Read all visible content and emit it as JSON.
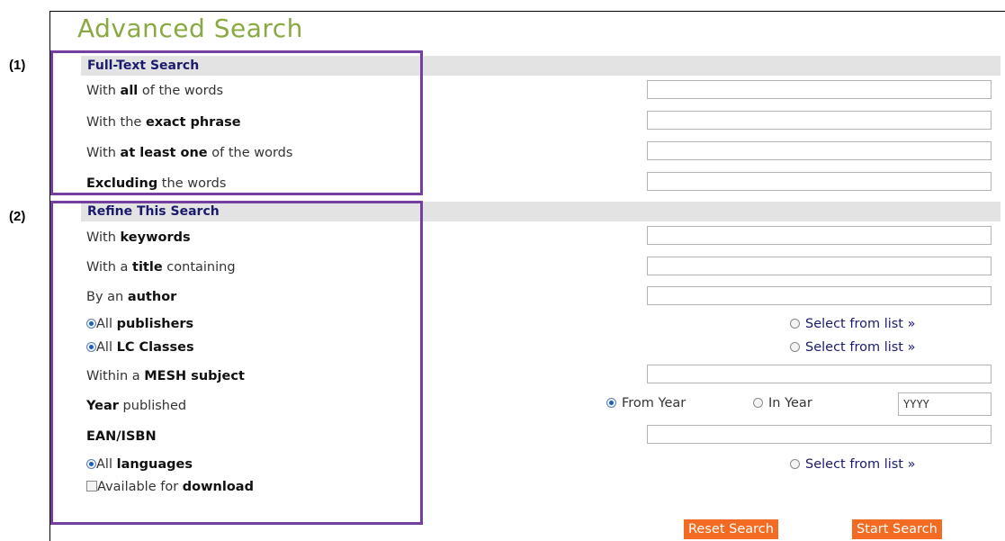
{
  "title": "Advanced Search",
  "markers": [
    "(1)",
    "(2)"
  ],
  "full_text": {
    "heading": "Full-Text Search",
    "rows": [
      {
        "pre": "With ",
        "bold": "all",
        "post": " of the words"
      },
      {
        "pre": "With the ",
        "bold": "exact phrase",
        "post": ""
      },
      {
        "pre": "With ",
        "bold": "at least one",
        "post": " of the words"
      },
      {
        "pre": "",
        "bold": "Excluding",
        "post": " the words"
      }
    ]
  },
  "refine": {
    "heading": "Refine This Search",
    "keywords": {
      "pre": "With ",
      "bold": "keywords",
      "post": ""
    },
    "title_row": {
      "pre": "With a ",
      "bold": "title",
      "post": " containing"
    },
    "author": {
      "pre": "By an ",
      "bold": "author",
      "post": ""
    },
    "publishers": {
      "pre": "All ",
      "bold": "publishers",
      "select": "Select from list »"
    },
    "lc_classes": {
      "pre": "All ",
      "bold": "LC Classes",
      "select": "Select from list »"
    },
    "mesh": {
      "pre": "Within a ",
      "bold": "MESH subject",
      "post": ""
    },
    "year": {
      "bold": "Year",
      "post": " published",
      "from_year": "From Year",
      "in_year": "In Year",
      "placeholder": "YYYY"
    },
    "isbn": {
      "bold": "EAN/ISBN"
    },
    "languages": {
      "pre": "All ",
      "bold": "languages",
      "select": "Select from list »"
    },
    "download": {
      "pre": "Available for ",
      "bold": "download"
    }
  },
  "buttons": {
    "reset": "Reset Search",
    "start": "Start Search"
  }
}
